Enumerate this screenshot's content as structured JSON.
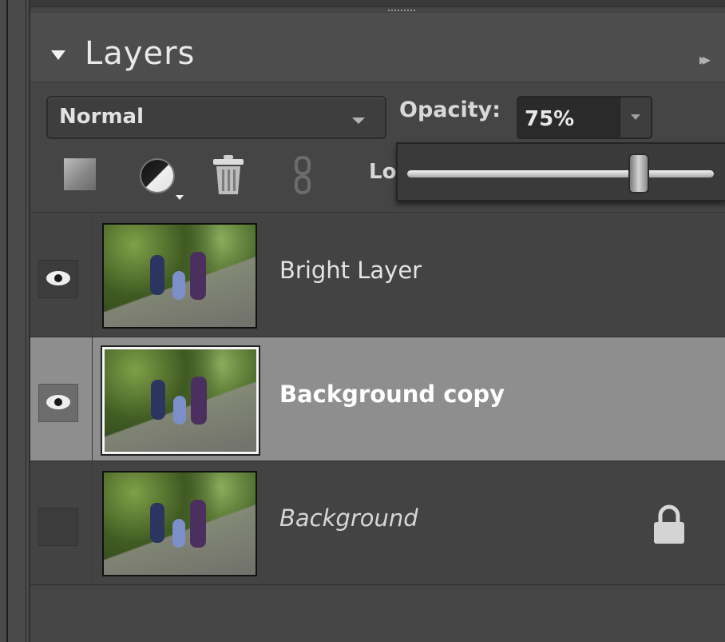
{
  "panel": {
    "title": "Layers",
    "more_glyph": "▸▸"
  },
  "blend_mode": {
    "selected": "Normal"
  },
  "opacity": {
    "label": "Opacity:",
    "value": "75%",
    "slider_fraction": 0.75
  },
  "lock": {
    "label": "Lo"
  },
  "toolbar": {
    "icons": [
      "new-layer-icon",
      "adjustment-layer-icon",
      "trash-icon",
      "link-icon"
    ]
  },
  "layers": [
    {
      "name": "Bright Layer",
      "visible": true,
      "selected": false,
      "locked": false,
      "italic": false
    },
    {
      "name": "Background copy",
      "visible": true,
      "selected": true,
      "locked": false,
      "italic": false
    },
    {
      "name": "Background",
      "visible": false,
      "selected": false,
      "locked": true,
      "italic": true
    }
  ],
  "colors": {
    "panel_bg": "#454545",
    "selected_row": "#8e8e8e",
    "text": "#e4e4e4"
  }
}
